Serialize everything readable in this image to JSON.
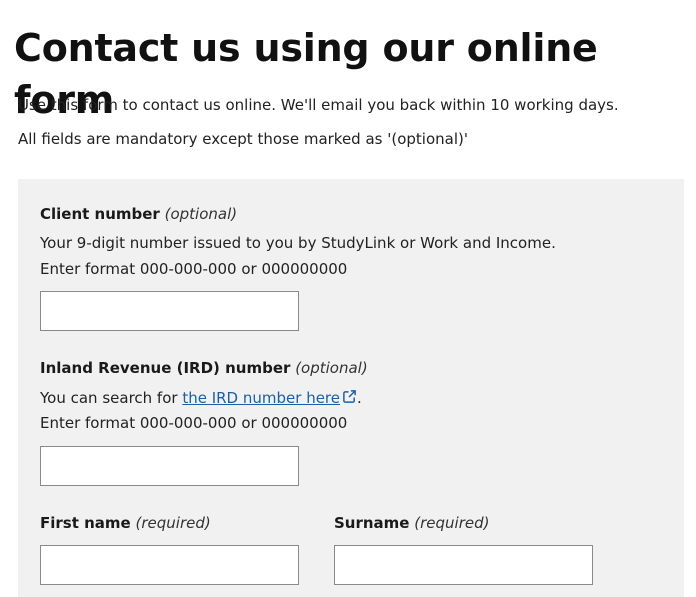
{
  "page": {
    "title": "Contact us using our online form",
    "intro": "Use this form to contact us online. We'll email you back within 10 working days.",
    "mandatory_note": "All fields are mandatory except those marked as '(optional)'"
  },
  "form": {
    "client_number": {
      "label": "Client number",
      "qualifier": "(optional)",
      "help_line1": "Your 9-digit number issued to you by StudyLink or Work and Income.",
      "help_line2": "Enter format 000-000-000 or 000000000",
      "value": ""
    },
    "ird_number": {
      "label": "Inland Revenue (IRD) number",
      "qualifier": "(optional)",
      "help_prefix": "You can search for ",
      "link_text": "the IRD number here",
      "help_suffix": ".",
      "help_line2": "Enter format 000-000-000 or 000000000",
      "value": ""
    },
    "first_name": {
      "label": "First name",
      "qualifier": "(required)",
      "value": ""
    },
    "surname": {
      "label": "Surname",
      "qualifier": "(required)",
      "value": ""
    }
  },
  "icons": {
    "external_link": "external-link-icon"
  },
  "colors": {
    "panel_bg": "#f1f1f1",
    "link": "#1d5fa6"
  }
}
